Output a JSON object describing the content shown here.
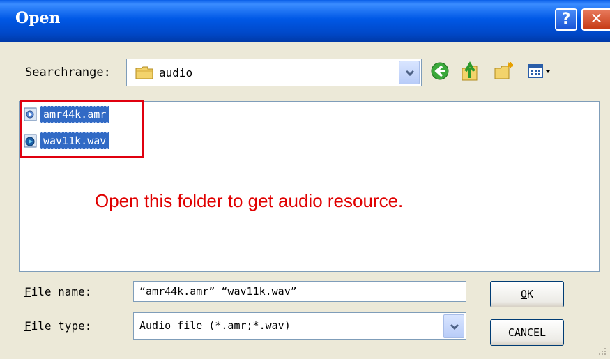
{
  "window": {
    "title": "Open"
  },
  "titlebar": {
    "help_glyph": "?",
    "close_glyph": "✕"
  },
  "toolbar": {
    "location_label_first": "S",
    "location_label_rest": "earchrange:",
    "location_value": "audio",
    "icons": [
      "folder-icon",
      "back-icon",
      "up-folder-icon",
      "new-folder-icon",
      "view-menu-icon"
    ]
  },
  "files": [
    {
      "name": "amr44k.amr",
      "icon": "audio-file-icon"
    },
    {
      "name": "wav11k.wav",
      "icon": "audio-file-icon"
    }
  ],
  "annotation": {
    "text": "Open this folder to get audio resource.",
    "color": "#e00000"
  },
  "form": {
    "file_name_label_first": "F",
    "file_name_label_rest": "ile name:",
    "file_name_value": "“amr44k.amr” “wav11k.wav”",
    "file_type_label_first": "F",
    "file_type_label_rest": "ile type:",
    "file_type_value": "Audio file (*.amr;*.wav)"
  },
  "buttons": {
    "ok_first": "O",
    "ok_rest": "K",
    "cancel_first": "C",
    "cancel_rest": "ANCEL"
  },
  "colors": {
    "titlebar": "#0058e6",
    "selection": "#316ac5",
    "highlight": "#e0000f"
  }
}
